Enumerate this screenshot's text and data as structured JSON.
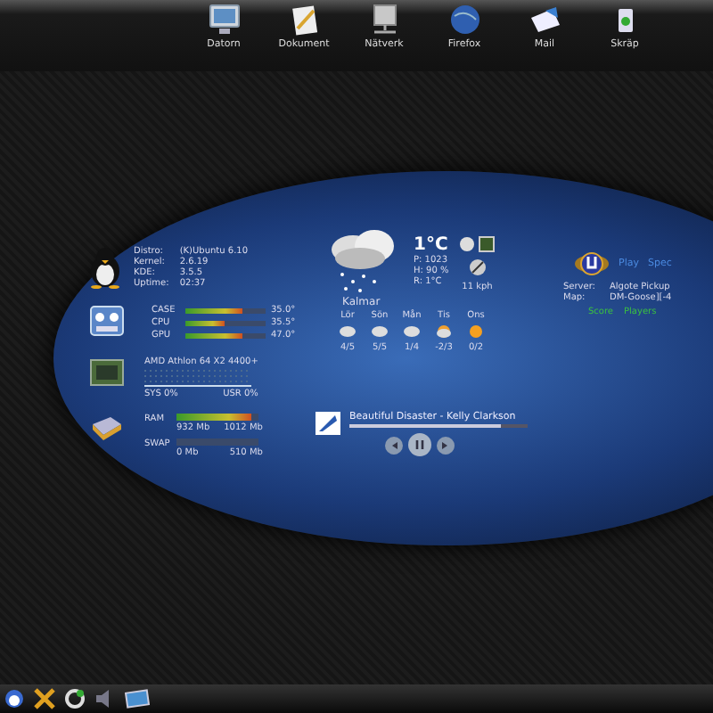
{
  "desktop_icons": [
    {
      "label": "Datorn",
      "kind": "monitor"
    },
    {
      "label": "Dokument",
      "kind": "document"
    },
    {
      "label": "Nätverk",
      "kind": "network"
    },
    {
      "label": "Firefox",
      "kind": "globe"
    },
    {
      "label": "Mail",
      "kind": "mail"
    },
    {
      "label": "Skräp",
      "kind": "trash"
    }
  ],
  "system_info": [
    {
      "label": "Distro:",
      "value": "(K)Ubuntu 6.10"
    },
    {
      "label": "Kernel:",
      "value": "2.6.19"
    },
    {
      "label": "KDE:",
      "value": "3.5.5"
    },
    {
      "label": "Uptime:",
      "value": "02:37"
    }
  ],
  "temperatures": [
    {
      "name": "CASE",
      "level": 0.7,
      "reading": "35.0°"
    },
    {
      "name": "CPU",
      "level": 0.48,
      "reading": "35.5°"
    },
    {
      "name": "GPU",
      "level": 0.7,
      "reading": "47.0°"
    }
  ],
  "cpu": {
    "model": "AMD Athlon 64 X2 4400+",
    "sys": "SYS 0%",
    "usr": "USR 0%"
  },
  "memory": [
    {
      "name": "RAM",
      "level": 0.92,
      "used": "932 Mb",
      "total": "1012 Mb"
    },
    {
      "name": "SWAP",
      "level": 0,
      "used": "0 Mb",
      "total": "510 Mb"
    }
  ],
  "weather": {
    "temperature": "1°C",
    "details": [
      "P: 1023",
      "H: 90 %",
      "R: 1°C"
    ],
    "wind": "11 kph",
    "city": "Kalmar",
    "forecast": [
      {
        "day": "Lör",
        "temps": "4/5",
        "kind": "cloud"
      },
      {
        "day": "Sön",
        "temps": "5/5",
        "kind": "cloud"
      },
      {
        "day": "Mån",
        "temps": "1/4",
        "kind": "cloud"
      },
      {
        "day": "Tis",
        "temps": "-2/3",
        "kind": "suncloud"
      },
      {
        "day": "Ons",
        "temps": "0/2",
        "kind": "sun"
      }
    ]
  },
  "game_server": {
    "actions": [
      "Play",
      "Spec"
    ],
    "info": [
      {
        "label": "Server:",
        "value": "Algote Pickup"
      },
      {
        "label": "Map:",
        "value": "DM-Goose][-4"
      }
    ],
    "tabs": [
      "Score",
      "Players"
    ]
  },
  "music": {
    "title": "Beautiful Disaster - Kelly Clarkson",
    "level": 0.85
  }
}
